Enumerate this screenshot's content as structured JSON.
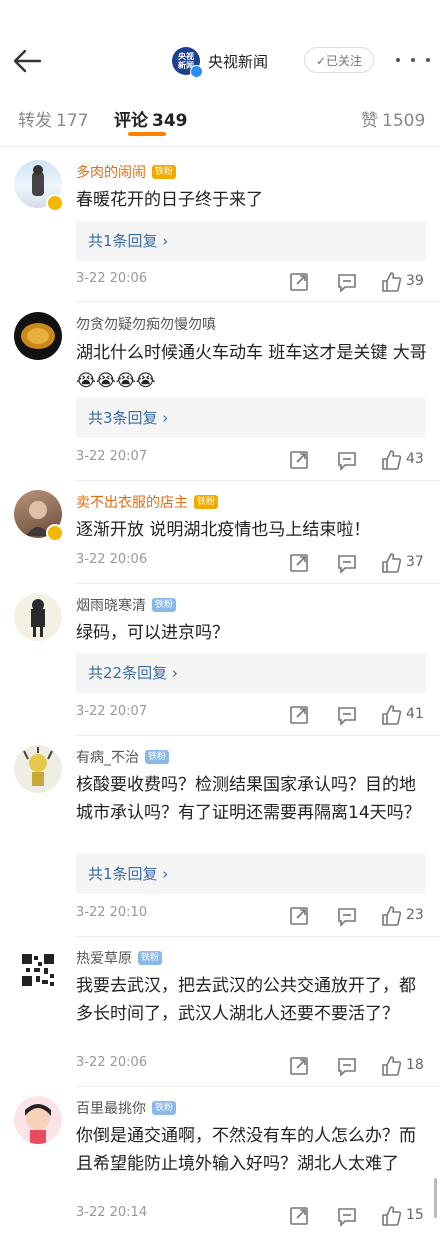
{
  "header": {
    "back_label": "back",
    "account_name": "央视新闻",
    "logo_text": "央视\n新闻",
    "follow_label": "✓已关注"
  },
  "tabs": [
    {
      "label": "转发",
      "count": "177"
    },
    {
      "label": "评论",
      "count": "349"
    },
    {
      "label": "赞",
      "count": "1509"
    }
  ],
  "comments": [
    {
      "user": "多肉的闹闹",
      "fan": "铁粉",
      "text": "春暖花开的日子终于来了",
      "reply": "共1条回复 ›",
      "time": "3-22 20:06",
      "likes": "39"
    },
    {
      "user": "勿贪勿疑勿痴勿慢勿嗔",
      "fan": "",
      "text": "湖北什么时候通火车动车 班车这才是关键 大哥😭😭😭😭",
      "reply": "共3条回复 ›",
      "time": "3-22 20:07",
      "likes": "43"
    },
    {
      "user": "卖不出衣服的店主",
      "fan": "铁粉",
      "text": "逐渐开放 说明湖北疫情也马上结束啦！",
      "reply": "",
      "time": "3-22 20:06",
      "likes": "37"
    },
    {
      "user": "烟雨晓寒清",
      "fan": "铁粉",
      "text": "绿码，可以进京吗？",
      "reply": "共22条回复 ›",
      "time": "3-22 20:07",
      "likes": "41"
    },
    {
      "user": "有病_不治",
      "fan": "铁粉",
      "text": "核酸要收费吗？检测结果国家承认吗？目的地城市承认吗？有了证明还需要再隔离14天吗？",
      "reply": "共1条回复 ›",
      "time": "3-22 20:10",
      "likes": "23"
    },
    {
      "user": "热爱草原",
      "fan": "铁粉",
      "text": "我要去武汉，把去武汉的公共交通放开了，都多长时间了，武汉人湖北人还要不要活了？",
      "reply": "",
      "time": "3-22 20:06",
      "likes": "18"
    },
    {
      "user": "百里最挑你",
      "fan": "铁粉",
      "text": "你倒是通交通啊，不然没有车的人怎么办？而且希望能防止境外输入好吗？湖北人太难了",
      "reply": "",
      "time": "3-22 20:14",
      "likes": "15"
    }
  ],
  "colors": {
    "accent": "#ff8200",
    "link": "#3b6aa8",
    "vip_name": "#e86b10"
  }
}
